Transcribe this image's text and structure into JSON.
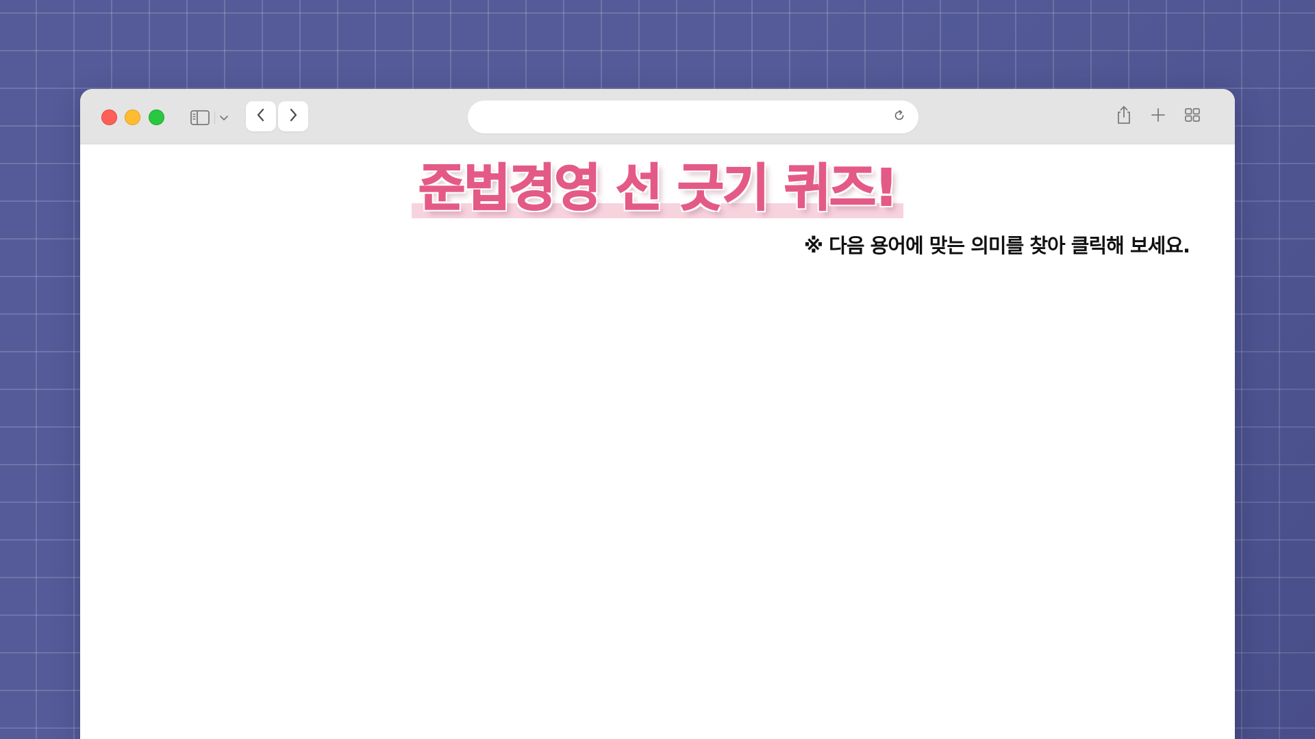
{
  "window": {
    "traffic_lights": {
      "close_color": "#fe5f57",
      "minimize_color": "#febc2e",
      "maximize_color": "#28c840"
    },
    "address_bar": {
      "value": "",
      "placeholder": ""
    },
    "icons": {
      "sidebar": "sidebar-toggle-icon",
      "chevron": "chevron-down-icon",
      "back": "chevron-left-icon",
      "forward": "chevron-right-icon",
      "reload": "reload-icon",
      "share": "share-icon",
      "new_tab": "plus-icon",
      "tabs_overview": "tab-grid-icon"
    }
  },
  "page": {
    "title": "준법경영 선 긋기 퀴즈!",
    "instruction": "※ 다음 용어에 맞는 의미를 찾아 클릭해 보세요."
  },
  "colors": {
    "background": "#545b98",
    "title_accent": "#e45a86",
    "title_highlight": "#f6cbd8",
    "toolbar": "#e4e4e4"
  }
}
